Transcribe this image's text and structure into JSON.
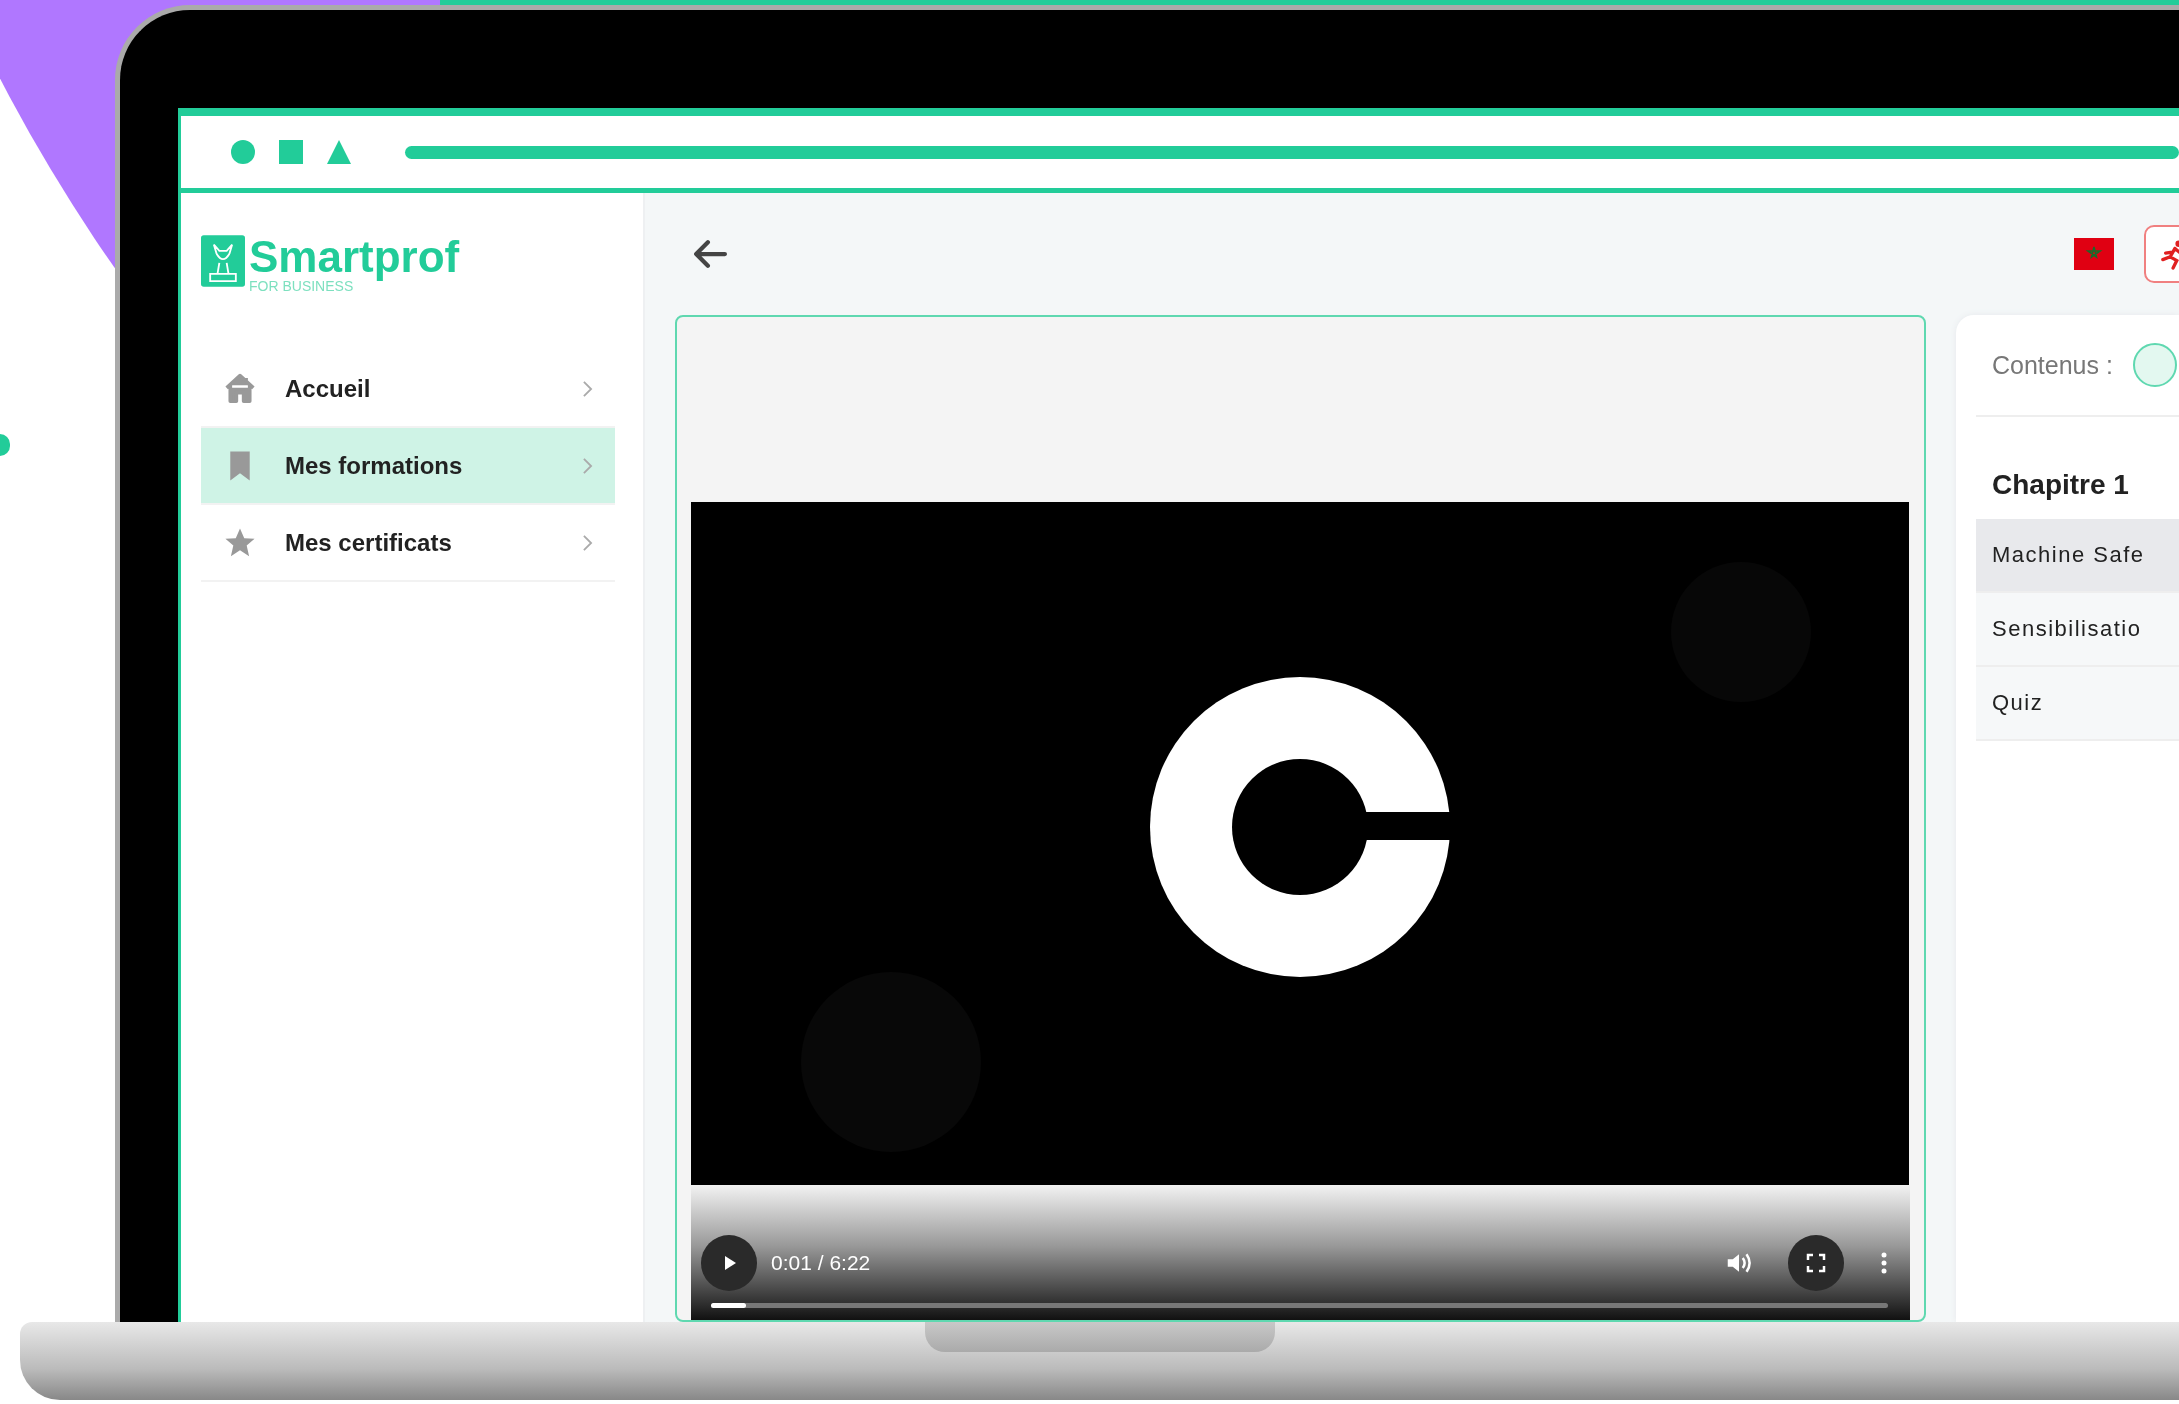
{
  "sidebar": {
    "logo": {
      "name": "Smartprof",
      "tagline": "FOR BUSINESS"
    },
    "items": [
      {
        "label": "Accueil",
        "kind": "home",
        "selected": false
      },
      {
        "label": "Mes formations",
        "kind": "bookmark",
        "selected": true
      },
      {
        "label": "Mes certificats",
        "kind": "star",
        "selected": false
      }
    ]
  },
  "video": {
    "time": "0:01 / 6:22",
    "level": 0.03
  },
  "contents_panel": {
    "title": "Contenus :",
    "chapters": [
      {
        "title": "Chapitre 1",
        "lessons": [
          {
            "label": "Machine Safe",
            "selected": true
          },
          {
            "label": "Sensibilisatio",
            "selected": false
          },
          {
            "label": "Quiz",
            "selected": false
          }
        ]
      }
    ]
  }
}
